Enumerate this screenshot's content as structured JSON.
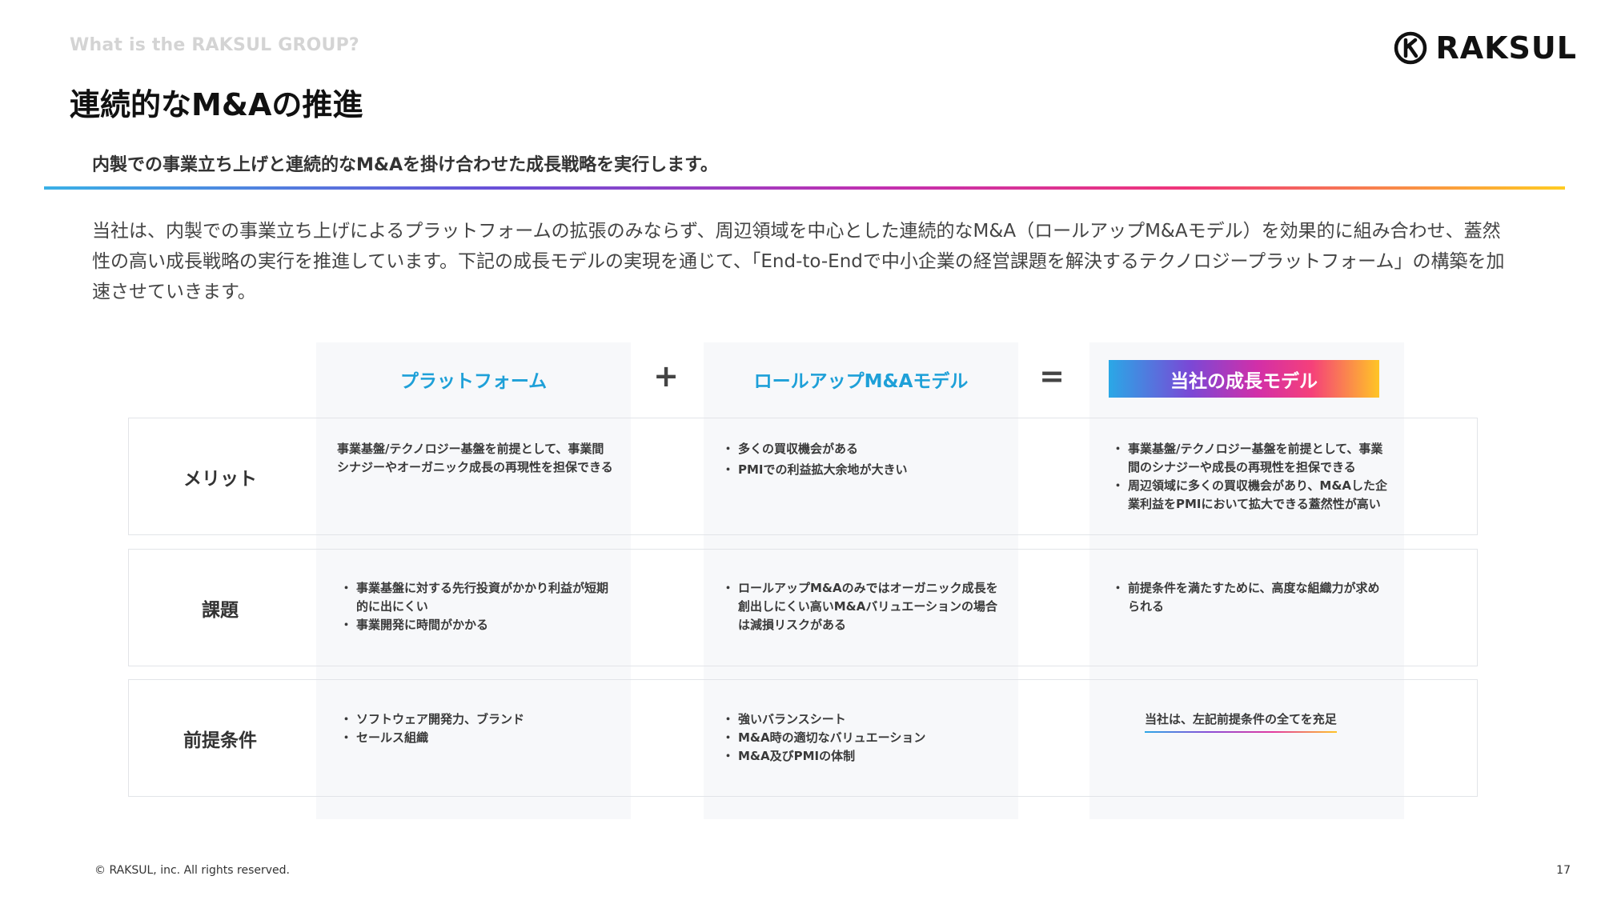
{
  "header": {
    "eyebrow": "What is the RAKSUL GROUP?",
    "title": "連続的なM&Aの推進",
    "logo_text": "RAKSUL"
  },
  "subtitle": "内製での事業立ち上げと連続的なM&Aを掛け合わせた成長戦略を実行します。",
  "intro": "当社は、内製での事業立ち上げによるプラットフォームの拡張のみならず、周辺領域を中心とした連続的なM&A（ロールアップM&Aモデル）を効果的に組み合わせ、蓋然性の高い成長戦略の実行を推進しています。下記の成長モデルの実現を通じて、「End-to-Endで中小企業の経営課題を解決するテクノロジープラットフォーム」の構築を加速させていきます。",
  "table": {
    "columns": {
      "platform": "プラットフォーム",
      "rollup": "ロールアップM&Aモデル",
      "growth": "当社の成長モデル"
    },
    "operators": {
      "plus": "+",
      "equals": "="
    },
    "rows": {
      "merit": {
        "label": "メリット",
        "platform": "事業基盤/テクノロジー基盤を前提として、事業間シナジーやオーガニック成長の再現性を担保できる",
        "rollup": [
          "多くの買収機会がある",
          "PMIでの利益拡大余地が大きい"
        ],
        "growth": [
          "事業基盤/テクノロジー基盤を前提として、事業間のシナジーや成長の再現性を担保できる",
          "周辺領域に多くの買収機会があり、M&Aした企業利益をPMIにおいて拡大できる蓋然性が高い"
        ]
      },
      "issue": {
        "label": "課題",
        "platform": [
          "事業基盤に対する先行投資がかかり利益が短期的に出にくい",
          "事業開発に時間がかかる"
        ],
        "rollup": [
          "ロールアップM&Aのみではオーガニック成長を創出しにくい高いM&Aバリュエーションの場合は減損リスクがある"
        ],
        "growth": [
          "前提条件を満たすために、高度な組織力が求められる"
        ]
      },
      "prerequisite": {
        "label": "前提条件",
        "platform": [
          "ソフトウェア開発力、ブランド",
          "セールス組織"
        ],
        "rollup": [
          "強いバランスシート",
          "M&A時の適切なバリュエーション",
          "M&A及びPMIの体制"
        ],
        "growth": "当社は、左記前提条件の全てを充足"
      }
    }
  },
  "footer": {
    "copyright": "© RAKSUL, inc. All rights reserved.",
    "page_number": "17"
  },
  "colors": {
    "accent_blue": "#1ea0d8",
    "gradient_start": "#2aa8e6",
    "gradient_mid": "#d22fa8",
    "gradient_end": "#ffc526"
  }
}
